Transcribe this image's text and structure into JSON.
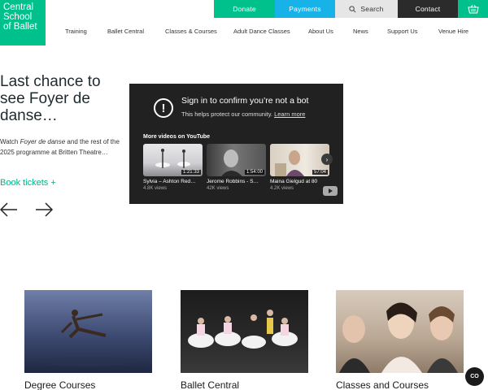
{
  "logo": {
    "line1": "Central",
    "line2": "School",
    "line3": "of Ballet"
  },
  "topbar": {
    "donate": "Donate",
    "payments": "Payments",
    "search": "Search",
    "contact": "Contact",
    "basket_icon": "basket-icon"
  },
  "nav": {
    "items": [
      "Training",
      "Ballet Central",
      "Classes & Courses",
      "Adult Dance Classes",
      "About Us",
      "News",
      "Support Us",
      "Venue Hire"
    ]
  },
  "hero": {
    "title": "Last chance to see Foyer de danse…",
    "desc_pre": "Watch ",
    "desc_em": "Foyer de danse",
    "desc_post": " and the rest of the 2025 programme at Britten Theatre…",
    "link": "Book tickets +"
  },
  "youtube": {
    "title": "Sign in to confirm you’re not a bot",
    "subtitle": "This helps protect our community.",
    "learn_more": "Learn more",
    "more_videos": "More videos on YouTube",
    "videos": [
      {
        "title": "Sylvia – Ashton Red…",
        "views": "4.8K views",
        "duration": "1:21:33"
      },
      {
        "title": "Jerome Robbins - S…",
        "views": "42K views",
        "duration": "1:54:00"
      },
      {
        "title": "Maina Gielgud at 80",
        "views": "4.2K views",
        "duration": "57:04"
      }
    ]
  },
  "cards": [
    {
      "title": "Degree Courses"
    },
    {
      "title": "Ballet Central"
    },
    {
      "title": "Classes and Courses"
    }
  ],
  "chat": {
    "label": "CO"
  },
  "colors": {
    "brand_green": "#00c08b",
    "payments_blue": "#17b2e8",
    "contact_dark": "#2b2b2b",
    "link_green": "#00b386"
  }
}
